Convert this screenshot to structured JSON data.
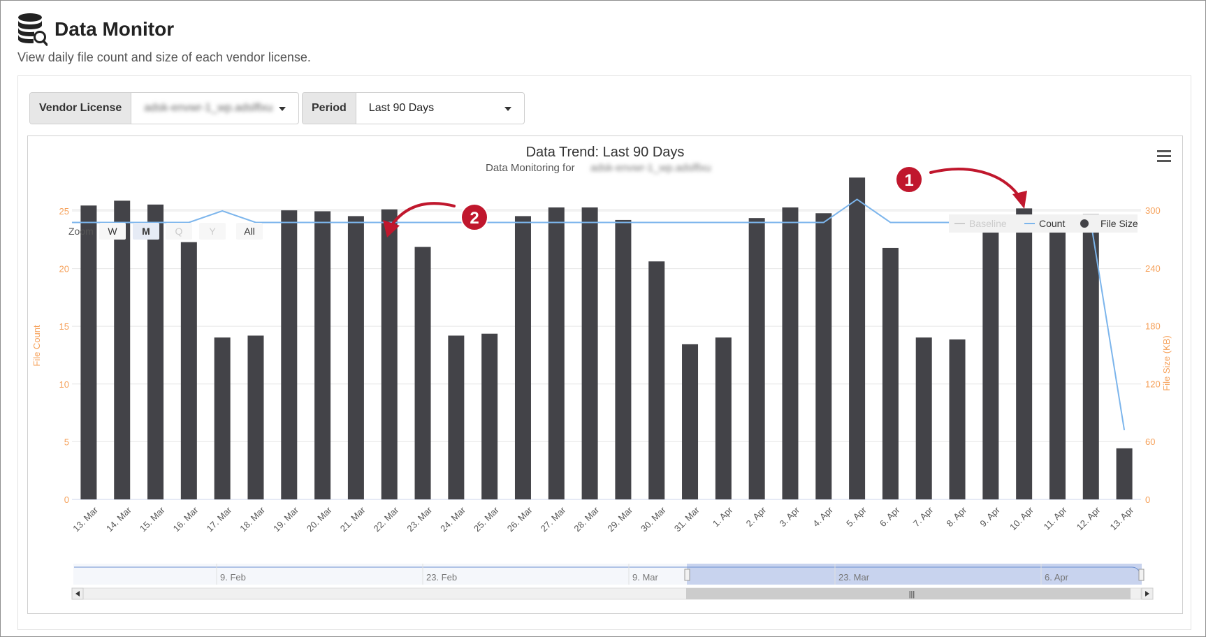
{
  "app": {
    "title": "Data Monitor",
    "subtitle": "View daily file count and size of each vendor license."
  },
  "filters": {
    "vendor_label": "Vendor License",
    "vendor_value": "adsk-envwr-1_wp.adslflxu",
    "period_label": "Period",
    "period_value": "Last 90 Days"
  },
  "zoom": {
    "label": "Zoom",
    "buttons": [
      "W",
      "M",
      "Q",
      "Y",
      "All"
    ],
    "active": "M",
    "disabled": [
      "Q",
      "Y"
    ]
  },
  "annotations": [
    "1",
    "2"
  ],
  "navigator": {
    "labels": [
      "9. Feb",
      "23. Feb",
      "9. Mar",
      "23. Mar",
      "6. Apr"
    ],
    "scroll_grip": "|||"
  },
  "icons": {
    "app": "database-search-icon",
    "menu": "hamburger-menu-icon"
  },
  "colors": {
    "bar": "#434348",
    "count_line": "#7cb5ec",
    "baseline": "#cccccc",
    "axis_title": "#f6a15a",
    "annotation": "#c0172d",
    "navigator_selection": "#c8d3ee"
  },
  "chart_data": {
    "type": "bar",
    "title": "Data Trend: Last 90 Days",
    "subtitle_prefix": "Data Monitoring for",
    "subtitle_value": "adsk-envwr-1_wp.adslflxu",
    "categories": [
      "13. Mar",
      "14. Mar",
      "15. Mar",
      "16. Mar",
      "17. Mar",
      "18. Mar",
      "19. Mar",
      "20. Mar",
      "21. Mar",
      "22. Mar",
      "23. Mar",
      "24. Mar",
      "25. Mar",
      "26. Mar",
      "27. Mar",
      "28. Mar",
      "29. Mar",
      "30. Mar",
      "31. Mar",
      "1. Apr",
      "2. Apr",
      "3. Apr",
      "4. Apr",
      "5. Apr",
      "6. Apr",
      "7. Apr",
      "8. Apr",
      "9. Apr",
      "10. Apr",
      "11. Apr",
      "12. Apr",
      "13. Apr"
    ],
    "y_left": {
      "title": "File Count",
      "ticks": [
        0,
        5,
        10,
        15,
        20,
        25
      ],
      "range": [
        0,
        25.3
      ]
    },
    "y_right": {
      "title": "File Size (KB)",
      "ticks": [
        0,
        60,
        120,
        180,
        240,
        300
      ],
      "range": [
        0,
        303
      ]
    },
    "series": [
      {
        "name": "Baseline",
        "type": "line",
        "visible": false
      },
      {
        "name": "Count",
        "type": "line",
        "axis": "left",
        "values": [
          24,
          24,
          24,
          24,
          25,
          24,
          24,
          24,
          24,
          24,
          24,
          24,
          24,
          24,
          24,
          24,
          24,
          24,
          24,
          24,
          24,
          24,
          24,
          26,
          24,
          24,
          24,
          24,
          24,
          24,
          24,
          6
        ]
      },
      {
        "name": "File Size",
        "type": "bar",
        "axis": "right",
        "values": [
          305,
          310,
          306,
          267,
          168,
          170,
          300,
          299,
          294,
          301,
          262,
          170,
          172,
          294,
          303,
          303,
          290,
          247,
          161,
          168,
          292,
          303,
          297,
          334,
          261,
          168,
          166,
          286,
          302,
          294,
          296,
          53
        ]
      }
    ],
    "legend_position": "top-right",
    "grid": true
  }
}
